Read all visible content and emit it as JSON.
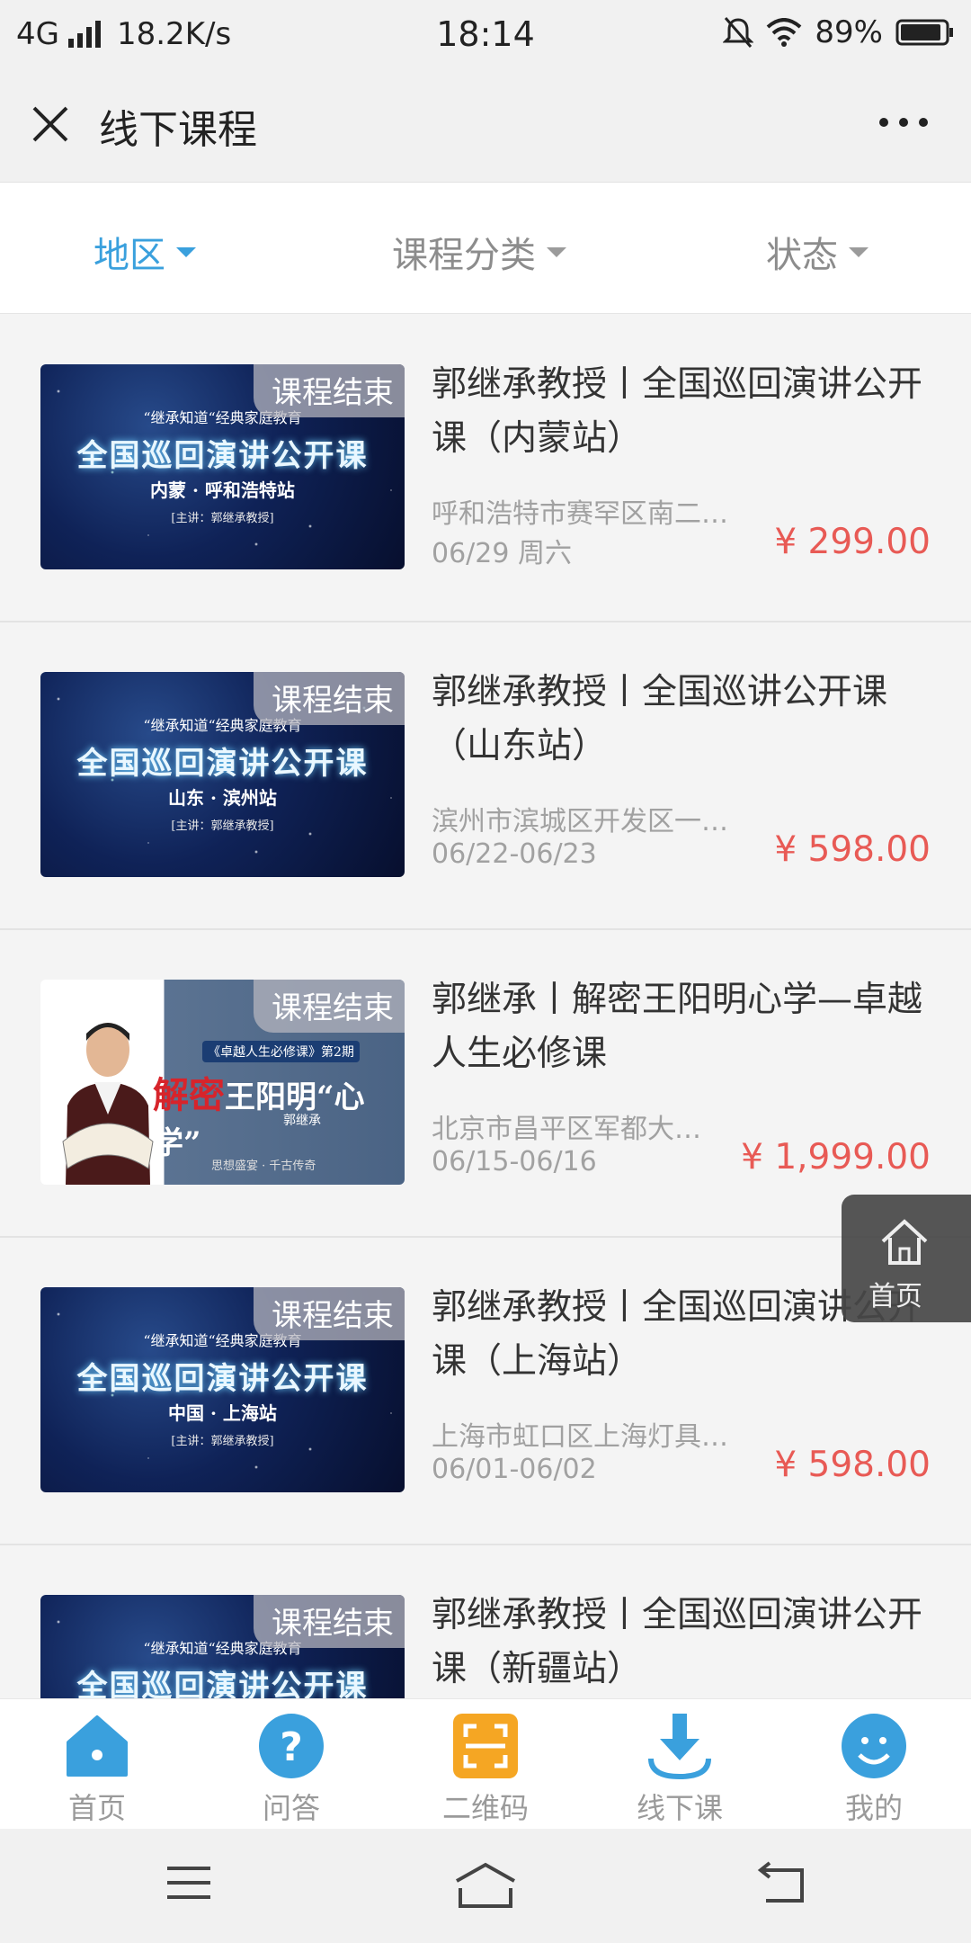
{
  "status_bar": {
    "network": "4G",
    "speed": "18.2K/s",
    "time": "18:14",
    "battery": "89%"
  },
  "header": {
    "title": "线下课程"
  },
  "filters": [
    {
      "label": "地区",
      "active": true
    },
    {
      "label": "课程分类",
      "active": false
    },
    {
      "label": "状态",
      "active": false
    }
  ],
  "courses": [
    {
      "badge": "课程结束",
      "title": "郭继承教授丨全国巡回演讲公开课（内蒙站）",
      "address": "呼和浩特市赛罕区南二…",
      "date": "06/29 周六",
      "price": "¥ 299.00",
      "thumb": {
        "line1": "“继承知道“经典家庭教育",
        "line2": "全国巡回演讲公开课",
        "line3": "内蒙 · 呼和浩特站",
        "line4": "[主讲：郭继承教授]"
      }
    },
    {
      "badge": "课程结束",
      "title": "郭继承教授丨全国巡讲公开课（山东站）",
      "address": "滨州市滨城区开发区一…",
      "date": "06/22-06/23",
      "price": "¥ 598.00",
      "thumb": {
        "line1": "“继承知道“经典家庭教育",
        "line2": "全国巡回演讲公开课",
        "line3": "山东 · 滨州站",
        "line4": "[主讲：郭继承教授]"
      }
    },
    {
      "badge": "课程结束",
      "title": "郭继承丨解密王阳明心学—卓越人生必修课",
      "address": "北京市昌平区军都大…",
      "date": "06/15-06/16",
      "price": "¥ 1,999.00",
      "thumb": {
        "series": "《卓越人生必修课》第2期",
        "title_red": "解密",
        "title_white": "王阳明“心学”",
        "author": "郭继承",
        "slogan": "思想盛宴 · 千古传奇"
      }
    },
    {
      "badge": "课程结束",
      "title": "郭继承教授丨全国巡回演讲公开课（上海站）",
      "address": "上海市虹口区上海灯具…",
      "date": "06/01-06/02",
      "price": "¥ 598.00",
      "thumb": {
        "line1": "“继承知道“经典家庭教育",
        "line2": "全国巡回演讲公开课",
        "line3": "中国 · 上海站",
        "line4": "[主讲：郭继承教授]"
      }
    },
    {
      "badge": "课程结束",
      "title": "郭继承教授丨全国巡回演讲公开课（新疆站）",
      "address": "",
      "date": "",
      "price": "",
      "thumb": {
        "line1": "“继承知道“经典家庭教育",
        "line2": "全国巡回演讲公开课",
        "line3": "",
        "line4": ""
      }
    }
  ],
  "floating": {
    "label": "首页"
  },
  "tabbar": [
    {
      "label": "首页",
      "icon": "home-icon",
      "color": "#3aa0dd"
    },
    {
      "label": "问答",
      "icon": "question-icon",
      "color": "#3aa0dd"
    },
    {
      "label": "二维码",
      "icon": "qrcode-icon",
      "color": "#f5a623"
    },
    {
      "label": "线下课",
      "icon": "download-icon",
      "color": "#3aa0dd"
    },
    {
      "label": "我的",
      "icon": "user-icon",
      "color": "#3aa0dd"
    }
  ]
}
